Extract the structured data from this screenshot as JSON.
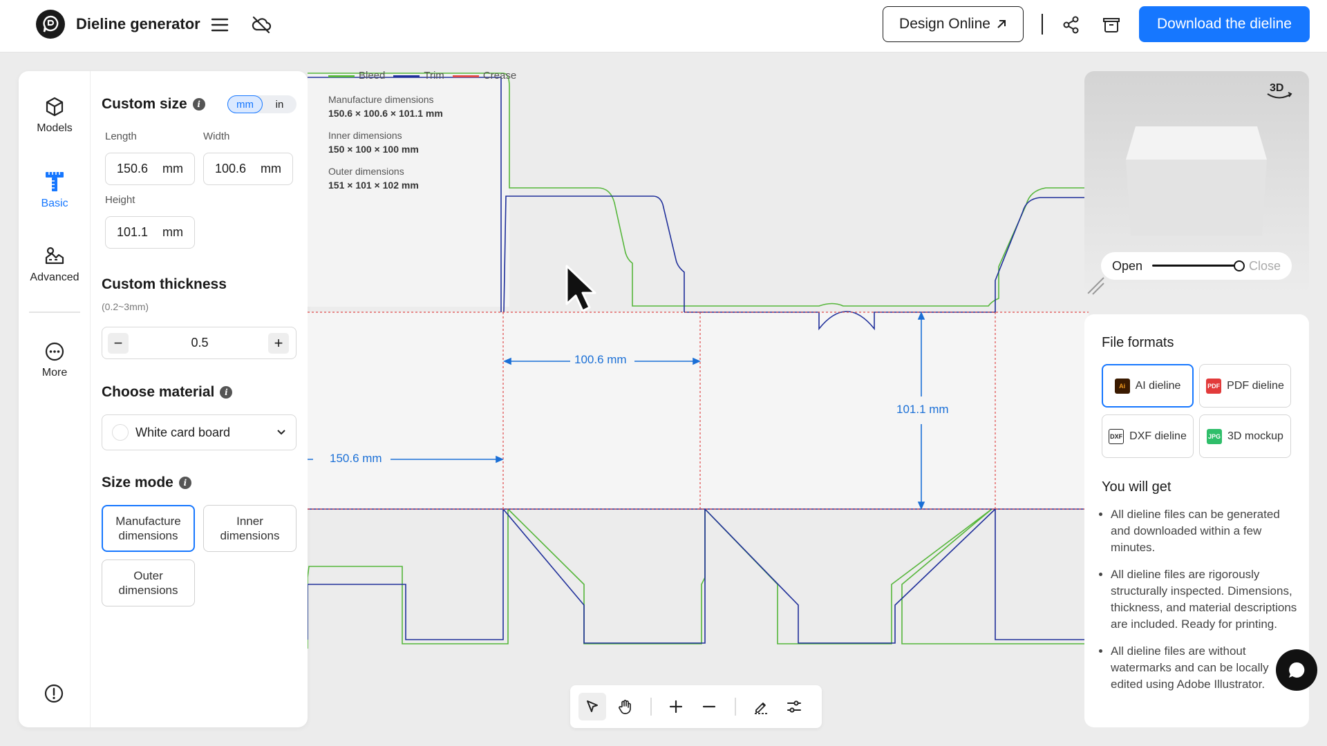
{
  "header": {
    "app_title": "Dieline generator",
    "design_online_label": "Design Online",
    "download_label": "Download the dieline",
    "icons": [
      "menu-icon",
      "cloud-off-icon",
      "share-icon",
      "box-icon",
      "arrow-up-right-icon"
    ]
  },
  "rail": {
    "items": [
      {
        "label": "Models",
        "icon": "cube-icon"
      },
      {
        "label": "Basic",
        "icon": "ruler-icon",
        "active": true
      },
      {
        "label": "Advanced",
        "icon": "advanced-measure-icon"
      },
      {
        "label": "More",
        "icon": "more-icon"
      }
    ],
    "bottom_icon": "alert-circle-icon"
  },
  "settings": {
    "custom_size": {
      "title": "Custom size",
      "units": [
        "mm",
        "in"
      ],
      "selected_unit": "mm",
      "length_label": "Length",
      "length_value": "150.6",
      "length_unit": "mm",
      "width_label": "Width",
      "width_value": "100.6",
      "width_unit": "mm",
      "height_label": "Height",
      "height_value": "101.1",
      "height_unit": "mm"
    },
    "thickness": {
      "title": "Custom thickness",
      "range": "(0.2~3mm)",
      "value": "0.5",
      "minus": "−",
      "plus": "+"
    },
    "material": {
      "title": "Choose material",
      "value": "White card board"
    },
    "size_mode": {
      "title": "Size mode",
      "options": [
        "Manufacture dimensions",
        "Inner dimensions",
        "Outer dimensions"
      ],
      "selected": "Manufacture dimensions"
    }
  },
  "canvas": {
    "legend": [
      {
        "label": "Bleed",
        "color": "#55b63a"
      },
      {
        "label": "Trim",
        "color": "#1f2f9a"
      },
      {
        "label": "Crease",
        "color": "#e04848"
      }
    ],
    "dims": {
      "manufacture_label": "Manufacture dimensions",
      "manufacture_value": "150.6 × 100.6 × 101.1 mm",
      "inner_label": "Inner dimensions",
      "inner_value": "150 × 100 × 100 mm",
      "outer_label": "Outer dimensions",
      "outer_value": "151 × 101 × 102 mm"
    },
    "measure_width": "100.6 mm",
    "measure_height": "101.1 mm",
    "measure_length": "150.6 mm"
  },
  "toolbar": {
    "tools": [
      "select-icon",
      "hand-icon",
      "zoom-in-icon",
      "zoom-out-icon",
      "edit-icon",
      "adjust-icon"
    ]
  },
  "preview": {
    "badge": "3D",
    "open_label": "Open",
    "close_label": "Close",
    "openness": 1.0
  },
  "file_formats": {
    "title": "File formats",
    "items": [
      {
        "label": "AI dieline",
        "icon": "Ai",
        "color": "#f29a1e",
        "selected": true
      },
      {
        "label": "PDF dieline",
        "icon": "PDF",
        "color": "#e23b3b"
      },
      {
        "label": "DXF dieline",
        "icon": "DXF",
        "color": "#222222"
      },
      {
        "label": "3D mockup",
        "icon": "JPG",
        "color": "#2fbe6a"
      }
    ]
  },
  "you_will_get": {
    "title": "You will get",
    "bullets": [
      "All dieline files can be generated and downloaded within a few minutes.",
      "All dieline files are rigorously structurally inspected. Dimensions, thickness, and material descriptions are included. Ready for printing.",
      "All dieline files are without watermarks and can be locally edited using Adobe Illustrator."
    ]
  },
  "colors": {
    "accent": "#1677ff",
    "bleed": "#55b63a",
    "trim": "#1f2f9a",
    "crease": "#e04848",
    "dimension": "#1a6fd6"
  }
}
